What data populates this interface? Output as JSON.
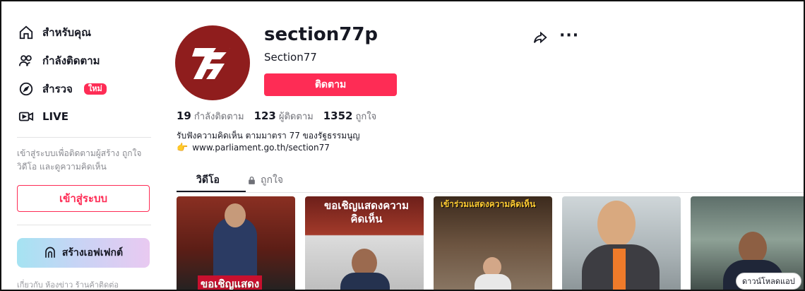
{
  "sidebar": {
    "nav": [
      {
        "label": "สำหรับคุณ",
        "icon": "home-icon"
      },
      {
        "label": "กำลังติดตาม",
        "icon": "users-icon"
      },
      {
        "label": "สำรวจ",
        "icon": "compass-icon",
        "badge": "ใหม่"
      },
      {
        "label": "LIVE",
        "icon": "live-icon"
      }
    ],
    "login_hint": "เข้าสู่ระบบเพื่อติดตามผู้สร้าง ถูกใจวิดีโอ และดูความคิดเห็น",
    "login_button": "เข้าสู่ระบบ",
    "effect_button": "สร้างเอฟเฟกต์",
    "footer_hint": "เกี่ยวกับ ห้องข่าว ร้านค้าติดต่อ"
  },
  "profile": {
    "username": "section77p",
    "nickname": "Section77",
    "follow_button": "ติดตาม",
    "stats": [
      {
        "value": "19",
        "label": "กำลังติดตาม"
      },
      {
        "value": "123",
        "label": "ผู้ติดตาม"
      },
      {
        "value": "1352",
        "label": "ถูกใจ"
      }
    ],
    "bio": "รับฟังความคิดเห็น ตามมาตรา 77 ของรัฐธรรมนูญ",
    "link": "www.parliament.go.th/section77"
  },
  "tabs": {
    "videos": "วิดีโอ",
    "liked": "ถูกใจ"
  },
  "videos": [
    {
      "caption": "ขอเชิญแสดง"
    },
    {
      "caption": "ขอเชิญแสดงความคิดเห็น"
    },
    {
      "caption": "เข้าร่วมแสดงความคิดเห็น"
    },
    {
      "caption": ""
    },
    {
      "caption": ""
    }
  ],
  "download_pill": "ดาวน์โหลดแอป",
  "colors": {
    "accent": "#fe2c55",
    "avatar_bg": "#8f1d1d"
  }
}
